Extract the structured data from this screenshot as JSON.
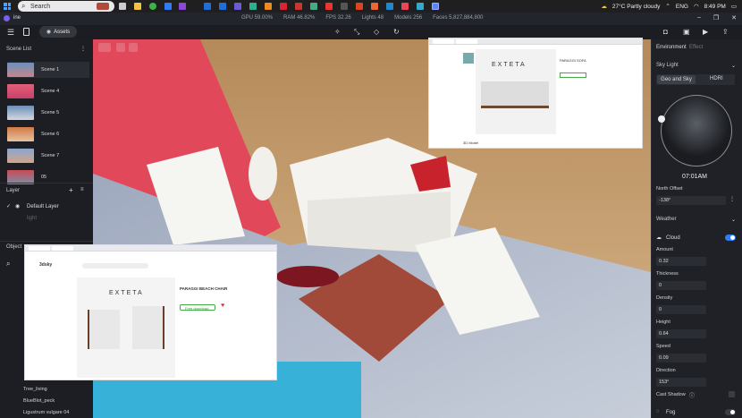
{
  "taskbar": {
    "search_placeholder": "Search",
    "weather": "27°C  Partly cloudy",
    "lang": "ENG",
    "time": "8:49 PM"
  },
  "app": {
    "name": "ine",
    "stats": [
      "GPU 59.00%",
      "RAM 46.82%",
      "FPS 32.26",
      "Lights 48",
      "Models 256",
      "Faces 5,827,884,800"
    ]
  },
  "toolbar": {
    "assets_label": "Assets"
  },
  "scene_list": {
    "title": "Scene List",
    "items": [
      {
        "label": "Scene 1",
        "color": "#c9878b"
      },
      {
        "label": "Scene 4",
        "color": "#e0546a"
      },
      {
        "label": "Scene 5",
        "color": "#6b8fb8"
      },
      {
        "label": "Scene 6",
        "color": "#d07a45"
      },
      {
        "label": "Scene 7",
        "color": "#8aa6cf"
      },
      {
        "label": "05",
        "color": "#c74b55"
      }
    ]
  },
  "layer": {
    "title": "Layer",
    "default": "Default Layer",
    "sub": "light"
  },
  "objects": {
    "title": "Object",
    "items": [
      "Tree_living",
      "BlueBlot_peck",
      "Ligustrum vulgare 04"
    ]
  },
  "browser_top": {
    "brand": "EXTETA",
    "product": "PARAGGI SOFA",
    "tab": "3D Model"
  },
  "browser_bottom": {
    "site": "3dsky",
    "brand": "EXTETA",
    "product": "PARAGGI BEACH CHAIR",
    "button": "Free download"
  },
  "right": {
    "tab_env": "Environment",
    "tab_effect": "Effect",
    "sky_light": "Sky Light",
    "geo_sky": "Geo and Sky",
    "hdri": "HDRI",
    "time": "07:01AM",
    "north_offset_label": "North Offset",
    "north_offset": "-138°",
    "weather": "Weather",
    "cloud": "Cloud",
    "amount_label": "Amount",
    "amount": "0.32",
    "thickness_label": "Thickness",
    "thickness": "0",
    "density_label": "Density",
    "density": "0",
    "height_label": "Height",
    "height": "0.64",
    "speed_label": "Speed",
    "speed": "0.09",
    "direction_label": "Direction",
    "direction": "153°",
    "cast_shadow": "Cast Shadow",
    "fog": "Fog"
  },
  "colors": {
    "accent": "#2f7cf6",
    "bg": "#1c1e23"
  }
}
